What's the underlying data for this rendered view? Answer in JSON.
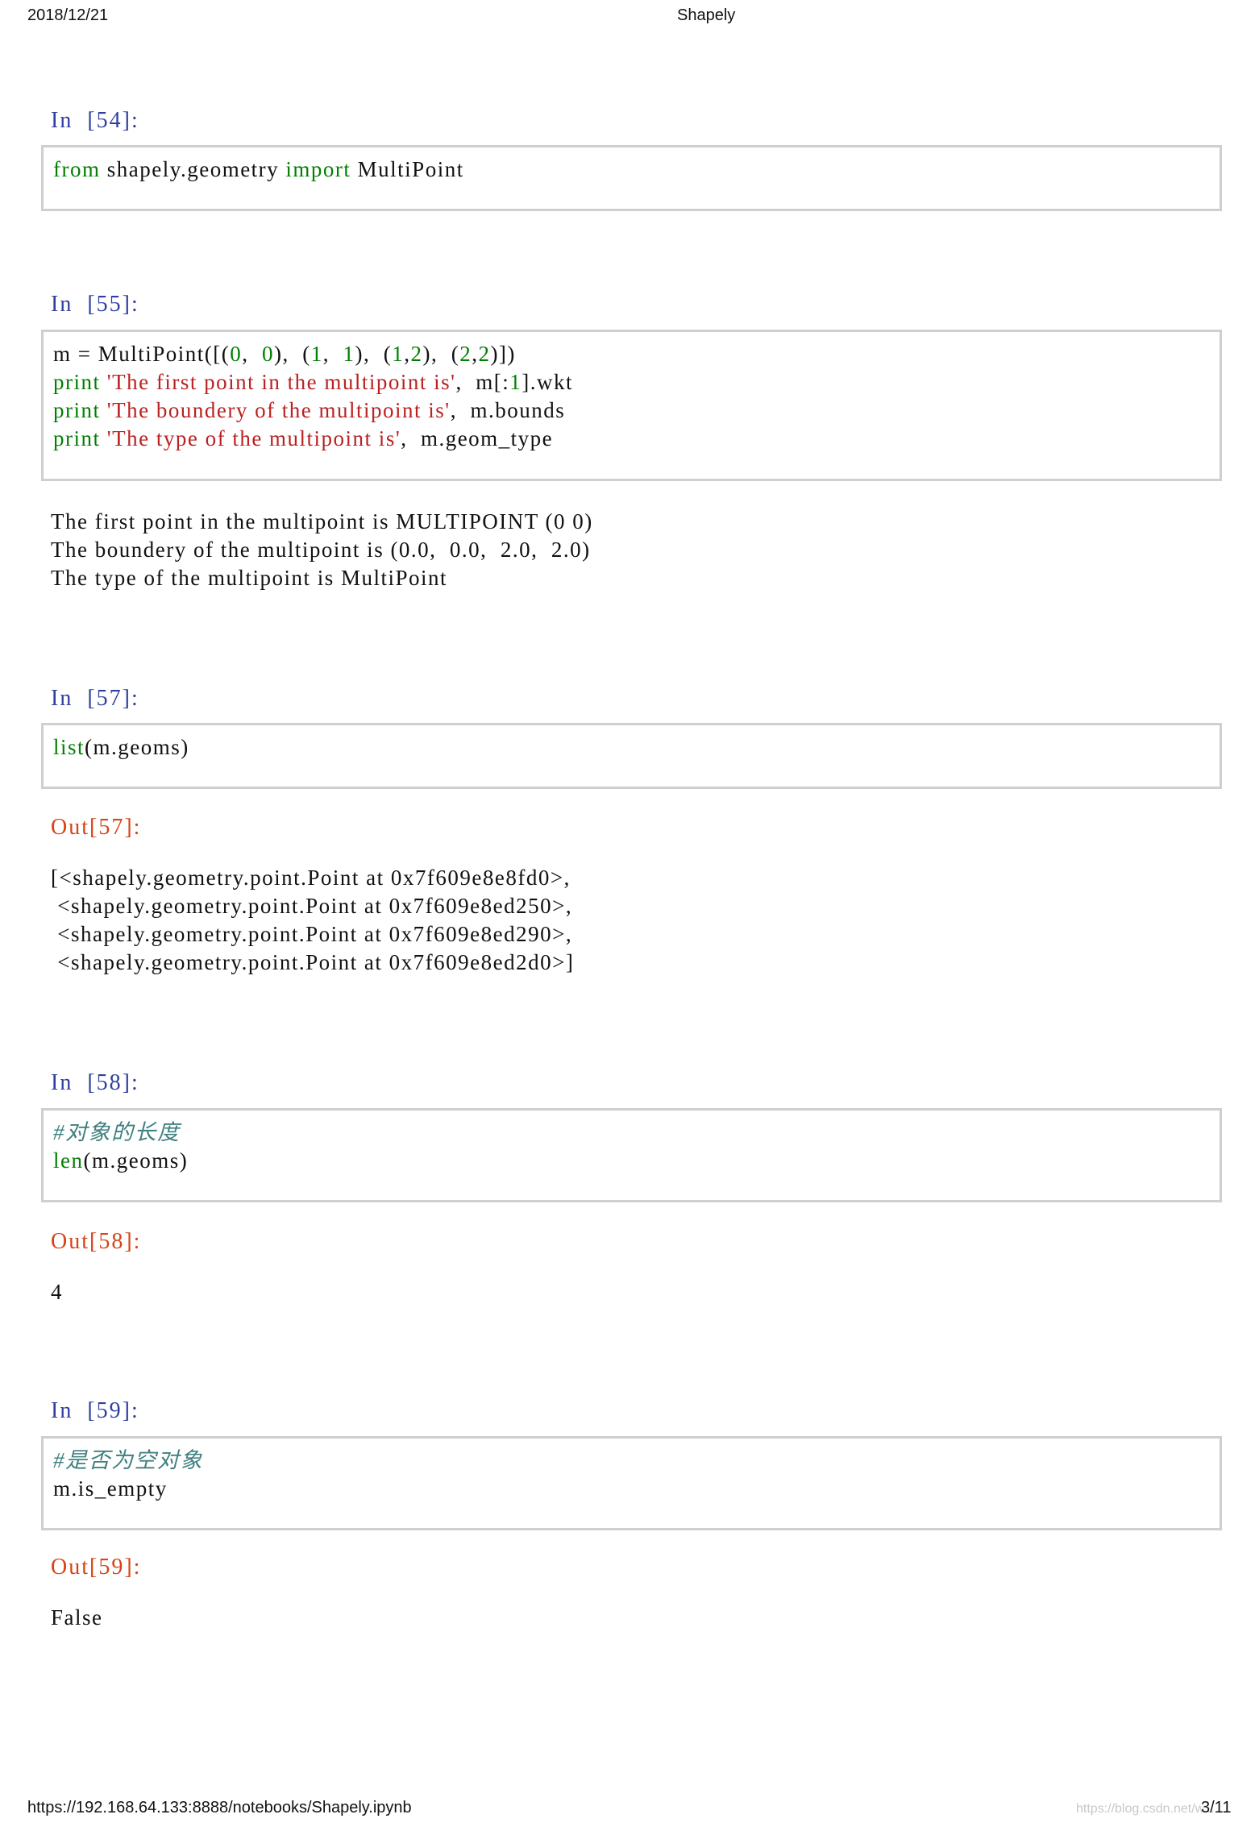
{
  "header": {
    "date": "2018/12/21",
    "title": "Shapely"
  },
  "footer": {
    "url": "https://192.168.64.133:8888/notebooks/Shapely.ipynb",
    "watermark": "https://blog.csdn.net/w...",
    "page": "3/11"
  },
  "cells": [
    {
      "prompt": "In  [54]:",
      "code": {
        "kw1": "from",
        "mid": " shapely.geometry ",
        "kw2": "import",
        "end": " MultiPoint"
      }
    },
    {
      "prompt": "In  [55]:",
      "line1": {
        "a": "m = MultiPoint([(",
        "n1": "0",
        "b": ",  ",
        "n2": "0",
        "c": "),  (",
        "n3": "1",
        "d": ",  ",
        "n4": "1",
        "e": "),  (",
        "n5": "1",
        "f": ",",
        "n6": "2",
        "g": "),  (",
        "n7": "2",
        "h": ",",
        "n8": "2",
        "i": ")])"
      },
      "line2": {
        "kw": "print",
        "str": " 'The first point in the multipoint is'",
        "rest": ",  m[:",
        "num": "1",
        "end": "].wkt"
      },
      "line3": {
        "kw": "print",
        "str": " 'The boundery of the multipoint is'",
        "rest": ",  m.bounds"
      },
      "line4": {
        "kw": "print",
        "str": " 'The type of the multipoint is'",
        "rest": ",  m.geom_type"
      },
      "output": [
        "The first point in the multipoint is MULTIPOINT (0 0)",
        "The boundery of the multipoint is (0.0,  0.0,  2.0,  2.0)",
        "The type of the multipoint is MultiPoint"
      ]
    },
    {
      "prompt": "In  [57]:",
      "code": {
        "fn": "list",
        "rest": "(m.geoms)"
      },
      "out_prompt": "Out[57]:",
      "output": [
        "[<shapely.geometry.point.Point at 0x7f609e8e8fd0>,",
        " <shapely.geometry.point.Point at 0x7f609e8ed250>,",
        " <shapely.geometry.point.Point at 0x7f609e8ed290>,",
        " <shapely.geometry.point.Point at 0x7f609e8ed2d0>]"
      ]
    },
    {
      "prompt": "In  [58]:",
      "code": {
        "comment": "#对象的长度",
        "fn": "len",
        "rest": "(m.geoms)"
      },
      "out_prompt": "Out[58]:",
      "output": "4"
    },
    {
      "prompt": "In  [59]:",
      "code": {
        "comment": "#是否为空对象",
        "line": "m.is_empty"
      },
      "out_prompt": "Out[59]:",
      "output": "False"
    }
  ]
}
